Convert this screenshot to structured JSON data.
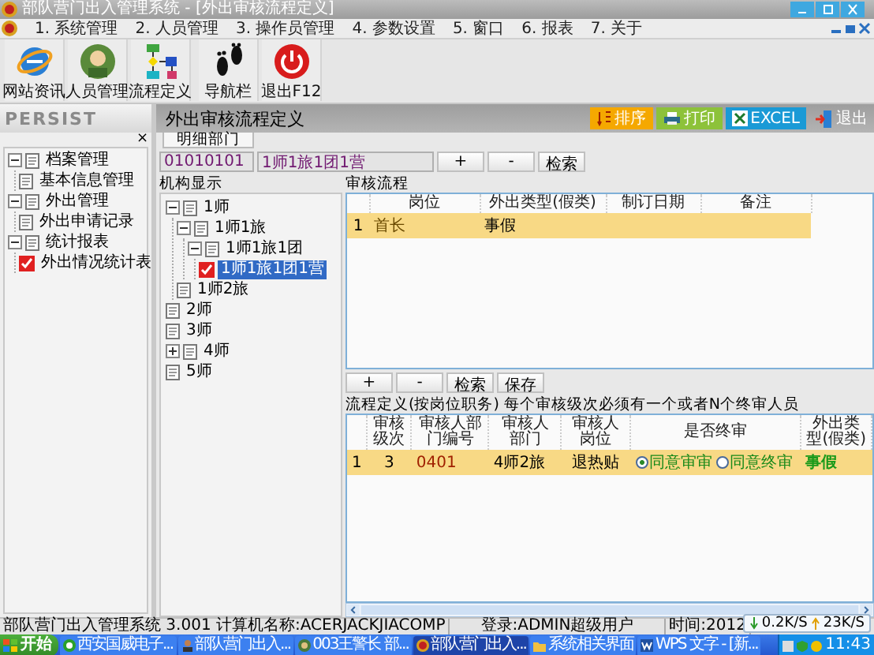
{
  "window": {
    "title": "部队营门出入管理系统 - [外出审核流程定义]"
  },
  "menu": [
    "1. 系统管理",
    "2. 人员管理",
    "3. 操作员管理",
    "4. 参数设置",
    "5. 窗口",
    "6. 报表",
    "7. 关于"
  ],
  "toolbar": [
    {
      "label": "网站资讯",
      "kind": "globe"
    },
    {
      "label": "人员管理",
      "kind": "person"
    },
    {
      "label": "流程定义",
      "kind": "flowchart"
    },
    {
      "label": "导航栏",
      "kind": "footprints"
    },
    {
      "label": "退出F12",
      "kind": "power"
    }
  ],
  "sidebar": {
    "logo": "PERSIST",
    "close": "×",
    "items": [
      {
        "label": "档案管理",
        "expanded": true,
        "checked": false,
        "children": [
          {
            "label": "基本信息管理",
            "checked": false
          }
        ]
      },
      {
        "label": "外出管理",
        "expanded": true,
        "checked": false,
        "children": [
          {
            "label": "外出申请记录",
            "checked": false
          }
        ]
      },
      {
        "label": "统计报表",
        "expanded": true,
        "checked": false,
        "children": [
          {
            "label": "外出情况统计表",
            "checked": true
          }
        ]
      }
    ]
  },
  "panel": {
    "title": "外出审核流程定义",
    "actions": [
      {
        "label": "排序",
        "kind": "sort",
        "color": "#f5a800"
      },
      {
        "label": "打印",
        "kind": "print",
        "color": "#8dc23a"
      },
      {
        "label": "EXCEL",
        "kind": "excel",
        "color": "#1a9ad6"
      },
      {
        "label": "退出",
        "kind": "exit"
      }
    ]
  },
  "tabs": [
    {
      "label": "明细部门",
      "selected": true
    }
  ],
  "filter": {
    "code": "01010101",
    "unit": "1师1旅1团1营",
    "buttons": [
      "+",
      "-",
      "检索"
    ]
  },
  "org_tree": {
    "label": "机构显示",
    "items": [
      {
        "label": "1师",
        "expanded": true,
        "checked": false,
        "selected": false,
        "children": [
          {
            "label": "1师1旅",
            "expanded": true,
            "checked": false,
            "selected": false,
            "children": [
              {
                "label": "1师1旅1团",
                "expanded": true,
                "checked": false,
                "selected": false,
                "children": [
                  {
                    "label": "1师1旅1团1营",
                    "checked": true,
                    "selected": true
                  }
                ]
              }
            ]
          },
          {
            "label": "1师2旅",
            "checked": false,
            "selected": false
          }
        ]
      },
      {
        "label": "2师",
        "checked": false,
        "selected": false
      },
      {
        "label": "3师",
        "checked": false,
        "selected": false
      },
      {
        "label": "4师",
        "expanded": false,
        "checked": false,
        "selected": false
      },
      {
        "label": "5师",
        "checked": false,
        "selected": false
      }
    ]
  },
  "flow": {
    "label": "审核流程",
    "columns": [
      "岗位",
      "外出类型(假类)",
      "制订日期",
      "备注"
    ],
    "rows": [
      {
        "index": "1",
        "position": "首长",
        "leave_type": "事假",
        "selected": true
      }
    ],
    "buttons": [
      "+",
      "-",
      "检索",
      "保存"
    ]
  },
  "rule_note": "流程定义(按岗位职务) 每个审核级次必须有一个或者N个终审人员",
  "approvers": {
    "columns": [
      "审核级次",
      "审核人部门编号",
      "审核人部门",
      "审核人岗位",
      "是否终审",
      "外出类型(假类)"
    ],
    "rows": [
      {
        "index": "1",
        "level": "3",
        "dept_code": "0401",
        "dept": "4师2旅",
        "post": "退热贴",
        "selected": true,
        "final_options": [
          {
            "label": "同意审审",
            "selected": true
          },
          {
            "label": "同意终审",
            "selected": false
          }
        ],
        "leave_type": "事假"
      }
    ]
  },
  "status_bar": {
    "items": [
      "部队营门出入管理系统 3.001 计算机名称:ACERJACKJIACOMP",
      "登录:ADMIN超级用户",
      "时间:2012"
    ],
    "download": "0.2K/S",
    "upload": "23K/S"
  },
  "taskbar": {
    "start": "开始",
    "tasks": [
      {
        "label": "西安国威电子...",
        "kind": "browser",
        "selected": false
      },
      {
        "label": "部队营门出入...",
        "kind": "person",
        "selected": false
      },
      {
        "label": "003王警长 部...",
        "kind": "badge",
        "selected": false
      },
      {
        "label": "部队营门出入...",
        "kind": "emblem",
        "selected": true
      },
      {
        "label": "系统相关界面",
        "kind": "folder",
        "selected": false
      },
      {
        "label": "WPS 文字 - [新...",
        "kind": "writer",
        "selected": false
      }
    ],
    "clock": "11:43"
  }
}
